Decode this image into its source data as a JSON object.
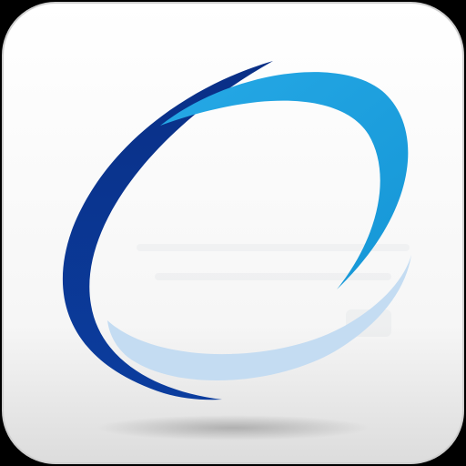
{
  "icon": {
    "name": "blue-swoosh-logo-app-icon",
    "colors": {
      "tile_light": "#ffffff",
      "tile_mid": "#f6f6f6",
      "tile_edge": "#dcdcdc",
      "tile_border": "#cfcfcf",
      "background": "#000000",
      "swoosh_dark_blue": "#0b3d9e",
      "swoosh_dark_blue_deep": "#0a2f86",
      "swoosh_light_blue": "#1596d6",
      "swoosh_light_blue_bright": "#26a9e6",
      "swoosh_pale_blue": "#c4dcf2",
      "shadow": "#9a9a9a"
    }
  }
}
